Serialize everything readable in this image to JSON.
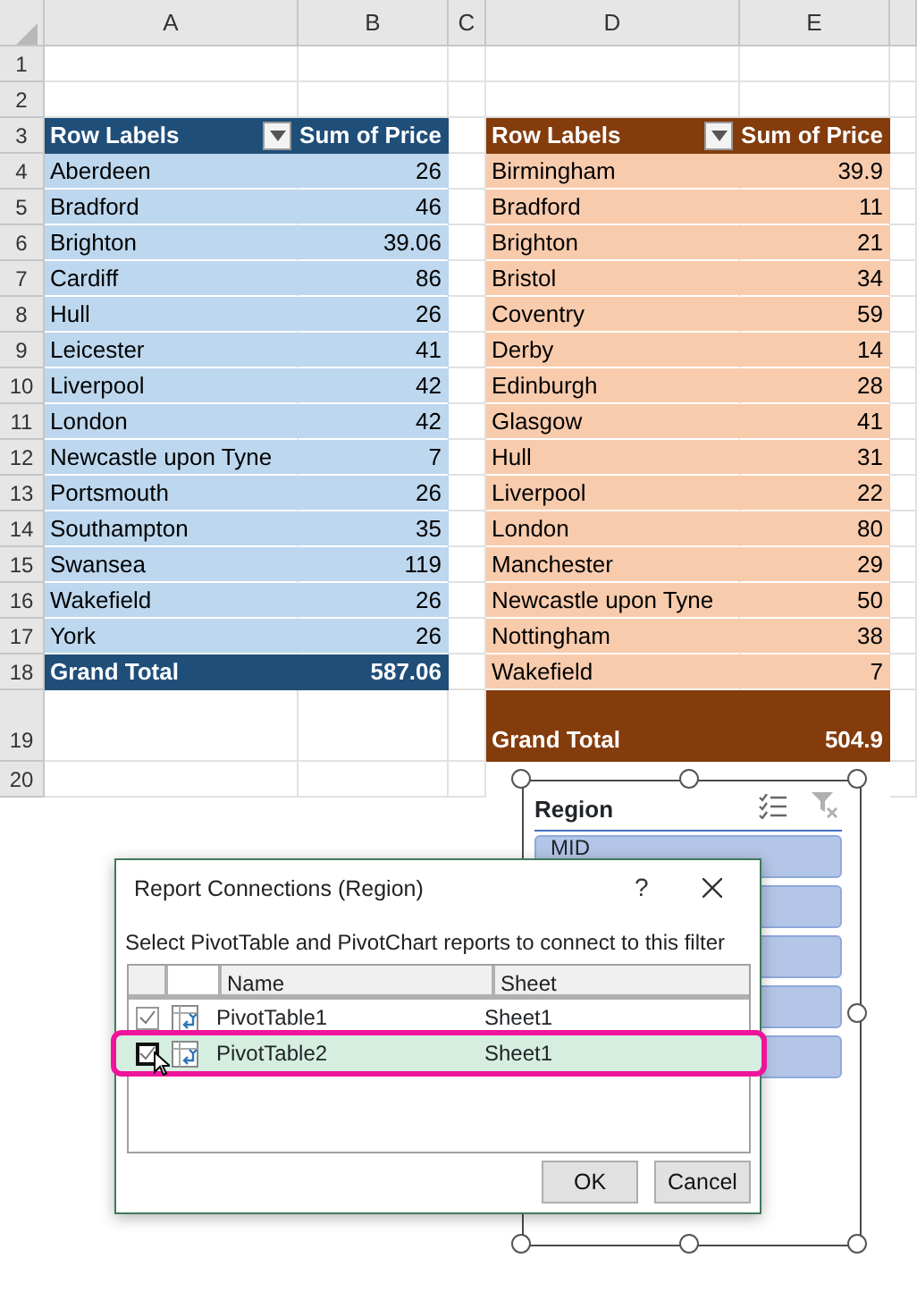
{
  "columns": [
    "A",
    "B",
    "C",
    "D",
    "E"
  ],
  "rows": [
    "1",
    "2",
    "3",
    "4",
    "5",
    "6",
    "7",
    "8",
    "9",
    "10",
    "11",
    "12",
    "13",
    "14",
    "15",
    "16",
    "17",
    "18",
    "19",
    "20"
  ],
  "pivot_tables": [
    {
      "kind": "blue",
      "header": {
        "row_labels": "Row Labels",
        "value": "Sum of Price"
      },
      "rows": [
        {
          "label": "Aberdeen",
          "value": "26"
        },
        {
          "label": "Bradford",
          "value": "46"
        },
        {
          "label": "Brighton",
          "value": "39.06"
        },
        {
          "label": "Cardiff",
          "value": "86"
        },
        {
          "label": "Hull",
          "value": "26"
        },
        {
          "label": "Leicester",
          "value": "41"
        },
        {
          "label": "Liverpool",
          "value": "42"
        },
        {
          "label": "London",
          "value": "42"
        },
        {
          "label": "Newcastle upon Tyne",
          "value": "7"
        },
        {
          "label": "Portsmouth",
          "value": "26"
        },
        {
          "label": "Southampton",
          "value": "35"
        },
        {
          "label": "Swansea",
          "value": "119"
        },
        {
          "label": "Wakefield",
          "value": "26"
        },
        {
          "label": "York",
          "value": "26"
        }
      ],
      "grand_total": {
        "label": "Grand Total",
        "value": "587.06"
      }
    },
    {
      "kind": "brown",
      "header": {
        "row_labels": "Row Labels",
        "value": "Sum of Price"
      },
      "rows": [
        {
          "label": "Birmingham",
          "value": "39.9"
        },
        {
          "label": "Bradford",
          "value": "11"
        },
        {
          "label": "Brighton",
          "value": "21"
        },
        {
          "label": "Bristol",
          "value": "34"
        },
        {
          "label": "Coventry",
          "value": "59"
        },
        {
          "label": "Derby",
          "value": "14"
        },
        {
          "label": "Edinburgh",
          "value": "28"
        },
        {
          "label": "Glasgow",
          "value": "41"
        },
        {
          "label": "Hull",
          "value": "31"
        },
        {
          "label": "Liverpool",
          "value": "22"
        },
        {
          "label": "London",
          "value": "80"
        },
        {
          "label": "Manchester",
          "value": "29"
        },
        {
          "label": "Newcastle upon Tyne",
          "value": "50"
        },
        {
          "label": "Nottingham",
          "value": "38"
        },
        {
          "label": "Wakefield",
          "value": "7"
        }
      ],
      "grand_total": {
        "label": "Grand Total",
        "value": "504.9"
      }
    }
  ],
  "slicer": {
    "title": "Region",
    "items": [
      {
        "label": "MID"
      }
    ]
  },
  "dialog": {
    "title": "Report Connections (Region)",
    "help": "?",
    "instruction": "Select PivotTable and PivotChart reports to connect to this filter",
    "columns": [
      "Name",
      "Sheet"
    ],
    "rows": [
      {
        "name": "PivotTable1",
        "sheet": "Sheet1",
        "checked": true,
        "selected": false
      },
      {
        "name": "PivotTable2",
        "sheet": "Sheet1",
        "checked": true,
        "selected": true
      }
    ],
    "buttons": [
      "OK",
      "Cancel"
    ]
  }
}
